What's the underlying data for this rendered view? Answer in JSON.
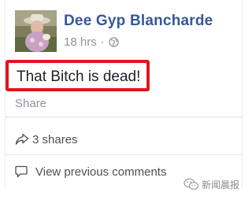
{
  "post": {
    "author_name": "Dee Gyp Blancharde",
    "timestamp": "18 hrs",
    "separator": "·",
    "privacy_icon": "globe-icon",
    "text": "That Bitch is dead!",
    "highlight_color": "#e1151f",
    "share_label": "Share",
    "shares_label": "3 shares",
    "view_comments_label": "View previous comments"
  },
  "watermark": {
    "text": "新闻晨报",
    "icon": "wechat-icon"
  },
  "colors": {
    "author_link": "#365899",
    "meta_gray": "#90949c",
    "body_text": "#1d2129"
  }
}
